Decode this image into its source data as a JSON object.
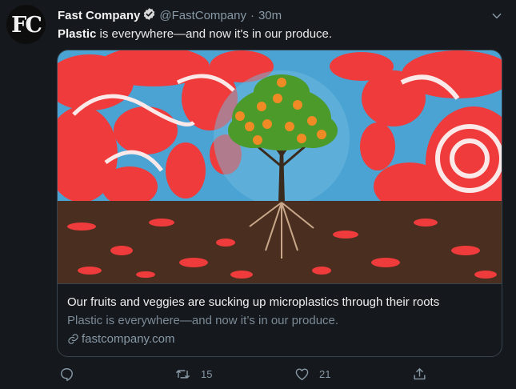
{
  "account": {
    "avatar_text": "FC",
    "name": "Fast Company",
    "handle": "@FastCompany",
    "separator": "·",
    "time": "30m"
  },
  "tweet": {
    "text_bold": "Plastic",
    "text_rest": " is everywhere—and now it's in our produce."
  },
  "card": {
    "title": "Our fruits and veggies are sucking up microplastics through their roots",
    "description": "Plastic is everywhere—and now it’s in our produce.",
    "domain": "fastcompany.com"
  },
  "actions": {
    "reply_count": "",
    "retweet_count": "15",
    "like_count": "21"
  },
  "icons": {
    "verified": "verified-badge-icon",
    "caret": "chevron-down-icon",
    "link": "link-icon",
    "reply": "reply-icon",
    "retweet": "retweet-icon",
    "like": "heart-icon",
    "share": "share-icon"
  },
  "colors": {
    "background": "#15181c",
    "secondary_text": "#8899a6",
    "card_border": "#38444d",
    "image_sky": "#4aa3d3",
    "image_plastic": "#ef3b3b",
    "image_soil": "#4a2f20"
  }
}
